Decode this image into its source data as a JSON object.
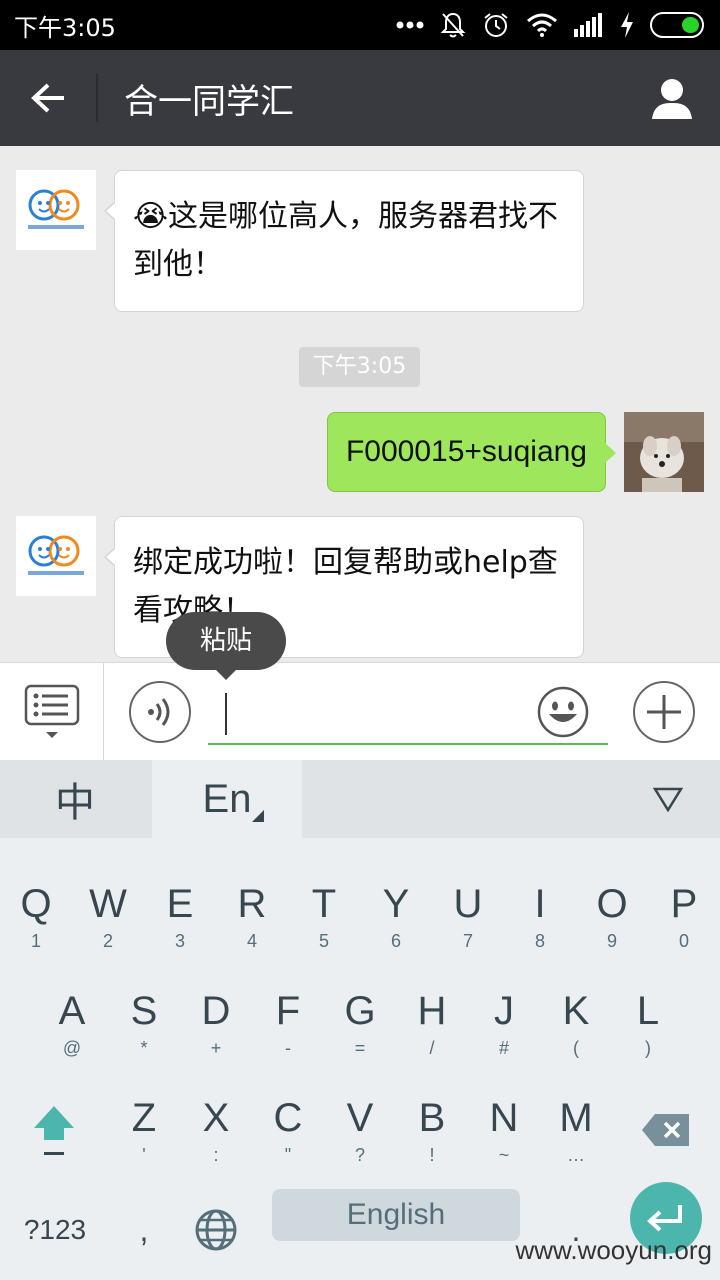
{
  "status_bar": {
    "time": "下午3:05",
    "icons": [
      "more-icon",
      "mute-icon",
      "alarm-icon",
      "wifi-icon",
      "signal-icon",
      "charging-icon",
      "battery-icon"
    ]
  },
  "header": {
    "title": "合一同学汇",
    "back_icon": "back-arrow-icon",
    "profile_icon": "person-icon",
    "bg_color": "#393a3f"
  },
  "chat": {
    "messages": [
      {
        "direction": "in",
        "text": "😭这是哪位高人，服务器君找不到他！",
        "avatar": "logo-avatar"
      },
      {
        "direction": "out",
        "text": "F000015+suqiang",
        "avatar": "dog-photo-avatar"
      },
      {
        "direction": "in",
        "text": "绑定成功啦！回复帮助或help查看攻略！",
        "avatar": "logo-avatar"
      }
    ],
    "timestamp": "下午3:05",
    "paste_tooltip": "粘贴",
    "bubble_out_color": "#9ee65b"
  },
  "input_bar": {
    "value": "",
    "menu_icon": "menu-list-icon",
    "voice_icon": "voice-icon",
    "emoji_icon": "smiley-icon",
    "plus_icon": "plus-icon",
    "underline_color": "#5cb85c"
  },
  "keyboard": {
    "tabs": {
      "chinese": "中",
      "english": "En"
    },
    "row1": [
      {
        "k": "Q",
        "s": "1"
      },
      {
        "k": "W",
        "s": "2"
      },
      {
        "k": "E",
        "s": "3"
      },
      {
        "k": "R",
        "s": "4"
      },
      {
        "k": "T",
        "s": "5"
      },
      {
        "k": "Y",
        "s": "6"
      },
      {
        "k": "U",
        "s": "7"
      },
      {
        "k": "I",
        "s": "8"
      },
      {
        "k": "O",
        "s": "9"
      },
      {
        "k": "P",
        "s": "0"
      }
    ],
    "row2": [
      {
        "k": "A",
        "s": "@"
      },
      {
        "k": "S",
        "s": "*"
      },
      {
        "k": "D",
        "s": "+"
      },
      {
        "k": "F",
        "s": "-"
      },
      {
        "k": "G",
        "s": "="
      },
      {
        "k": "H",
        "s": "/"
      },
      {
        "k": "J",
        "s": "#"
      },
      {
        "k": "K",
        "s": "("
      },
      {
        "k": "L",
        "s": ")"
      }
    ],
    "row3": [
      {
        "k": "Z",
        "s": "'"
      },
      {
        "k": "X",
        "s": ":"
      },
      {
        "k": "C",
        "s": "\""
      },
      {
        "k": "V",
        "s": "?"
      },
      {
        "k": "B",
        "s": "!"
      },
      {
        "k": "N",
        "s": "~"
      },
      {
        "k": "M",
        "s": "…"
      }
    ],
    "numbers_key": "?123",
    "comma_key": ",",
    "space_label": "English",
    "period_key": ".",
    "enter_color": "#4db6ac",
    "shift_color": "#4db6ac"
  },
  "watermark": "www.wooyun.org"
}
